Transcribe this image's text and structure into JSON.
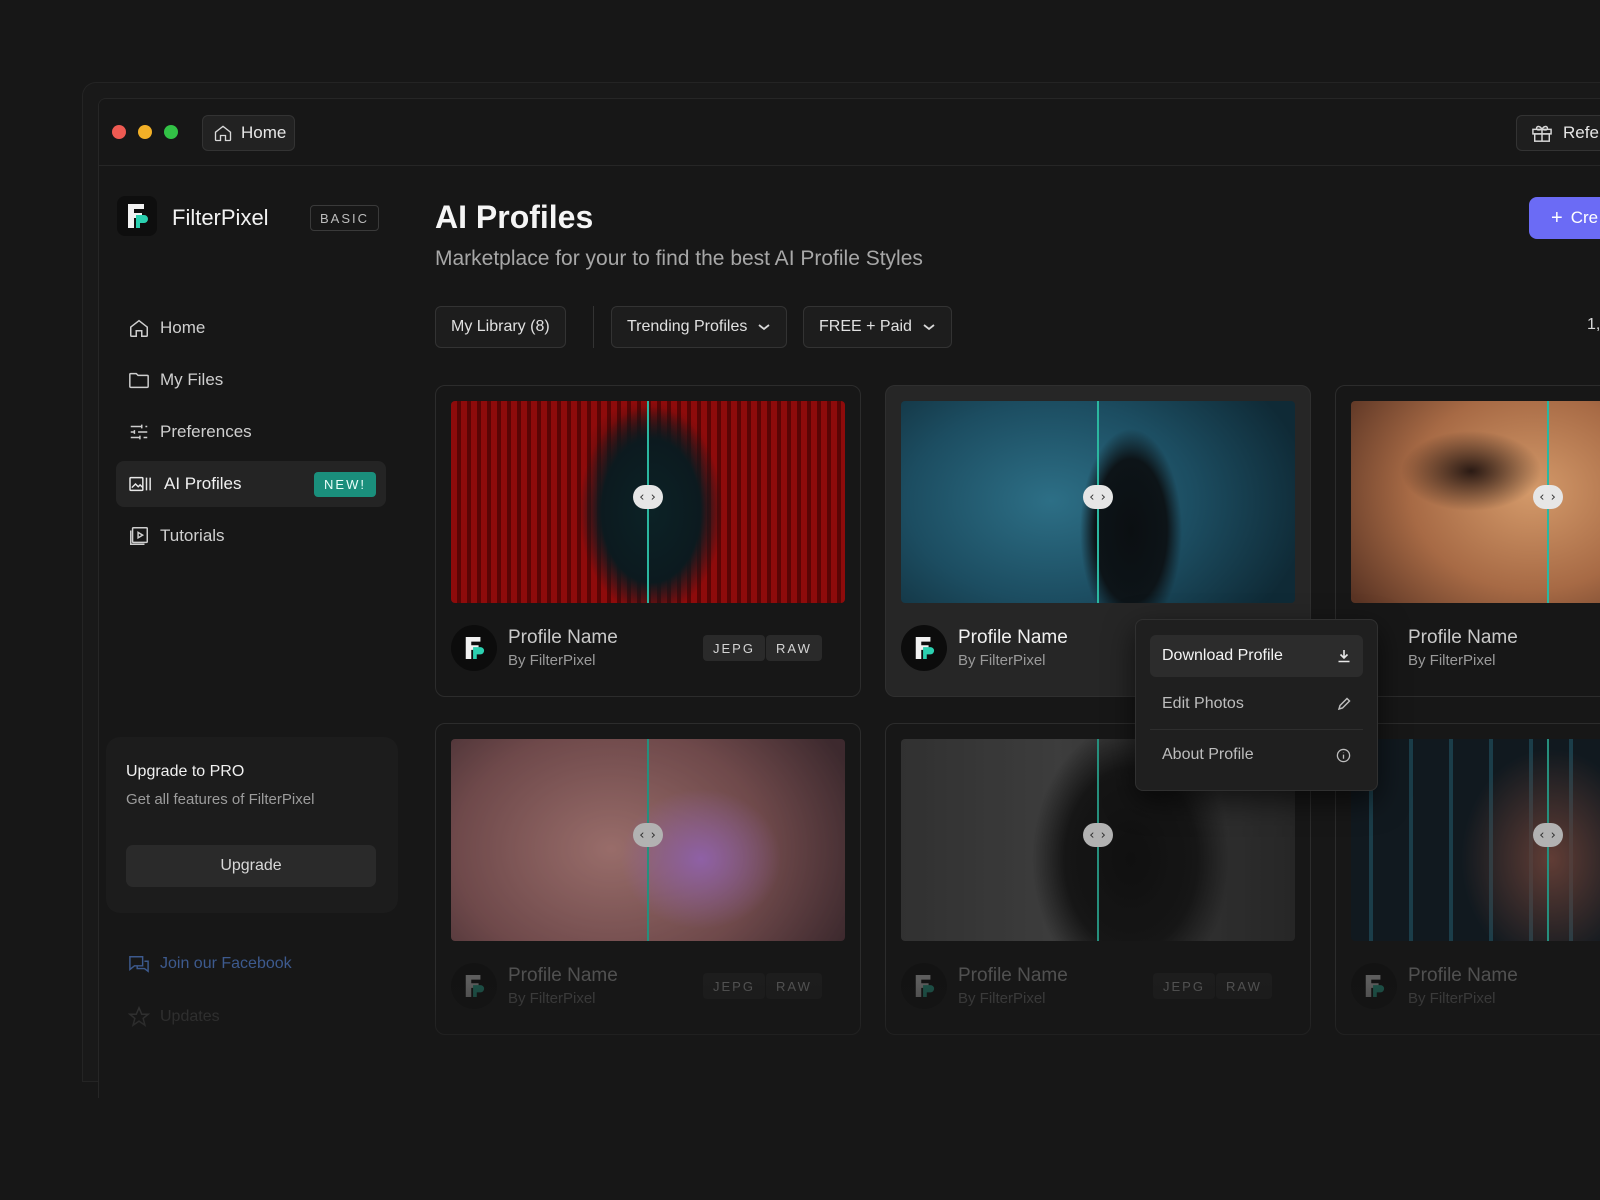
{
  "titlebar": {
    "home_tab": "Home",
    "refer_button": "Refer"
  },
  "sidebar": {
    "brand": "FilterPixel",
    "plan_badge": "BASIC",
    "items": [
      {
        "label": "Home",
        "icon": "home-icon"
      },
      {
        "label": "My Files",
        "icon": "folder-icon"
      },
      {
        "label": "Preferences",
        "icon": "sliders-icon"
      },
      {
        "label": "AI Profiles",
        "icon": "ai-profiles-icon",
        "badge": "NEW!",
        "active": true
      },
      {
        "label": "Tutorials",
        "icon": "play-icon"
      }
    ],
    "upgrade": {
      "title": "Upgrade to PRO",
      "subtitle": "Get all features of FilterPixel",
      "button": "Upgrade"
    },
    "facebook_link": "Join our Facebook",
    "updates_link": "Updates"
  },
  "main": {
    "title": "AI Profiles",
    "subtitle": "Marketplace for your to find the best AI Profile Styles",
    "create_button": "Cre",
    "filters": {
      "library": "My Library (8)",
      "sort": "Trending Profiles",
      "price": "FREE + Paid"
    },
    "count": "1,"
  },
  "cards": [
    {
      "name": "Profile Name",
      "by": "By FilterPixel",
      "tags": [
        "JEPG",
        "RAW"
      ]
    },
    {
      "name": "Profile Name",
      "by": "By FilterPixel",
      "tags": []
    },
    {
      "name": "Profile Name",
      "by": "By FilterPixel",
      "tags": []
    },
    {
      "name": "Profile Name",
      "by": "By FilterPixel",
      "tags": [
        "JEPG",
        "RAW"
      ]
    },
    {
      "name": "Profile Name",
      "by": "By FilterPixel",
      "tags": [
        "JEPG",
        "RAW"
      ]
    },
    {
      "name": "Profile Name",
      "by": "By FilterPixel",
      "tags": []
    }
  ],
  "context_menu": {
    "items": [
      {
        "label": "Download Profile",
        "icon": "download-icon"
      },
      {
        "label": "Edit Photos",
        "icon": "pencil-icon"
      },
      {
        "label": "About Profile",
        "icon": "info-icon"
      }
    ]
  },
  "colors": {
    "accent": "#6b6bf5",
    "teal": "#1a8f7c",
    "compare_line": "#2bb7a0",
    "background": "#171717"
  }
}
